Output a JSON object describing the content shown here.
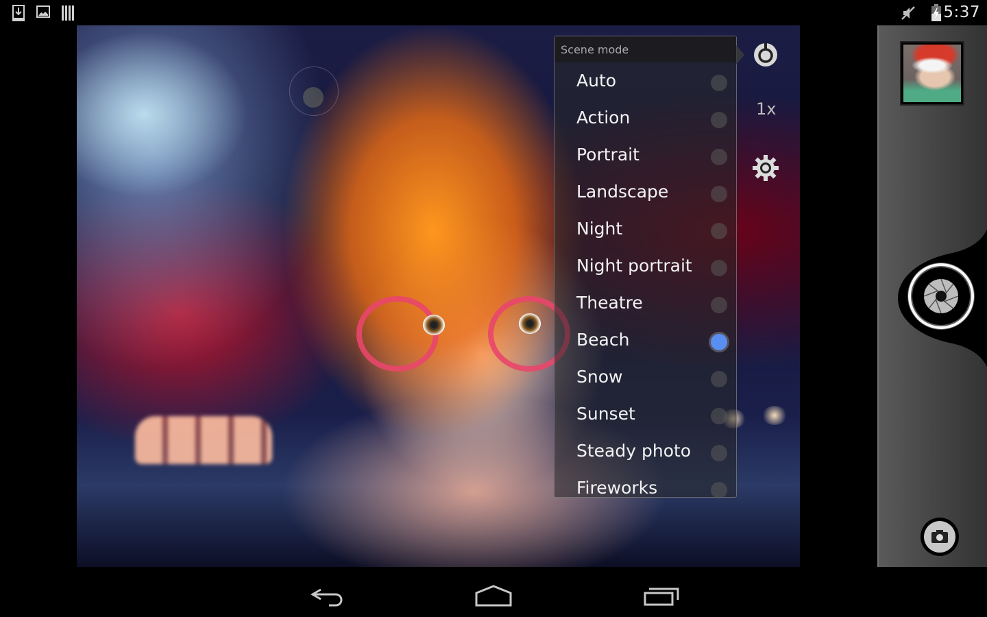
{
  "status_bar": {
    "left_icons": [
      "download-notification-icon",
      "gallery-notification-icon",
      "barcode-notification-icon"
    ],
    "right_icons": [
      "mute-icon",
      "battery-charging-icon"
    ],
    "time": "5:37"
  },
  "viewfinder": {
    "subject": "child with red glasses"
  },
  "scene_mode_popup": {
    "title": "Scene mode",
    "selected": "Beach",
    "options": [
      {
        "label": "Auto",
        "selected": false
      },
      {
        "label": "Action",
        "selected": false
      },
      {
        "label": "Portrait",
        "selected": false
      },
      {
        "label": "Landscape",
        "selected": false
      },
      {
        "label": "Night",
        "selected": false
      },
      {
        "label": "Night portrait",
        "selected": false
      },
      {
        "label": "Theatre",
        "selected": false
      },
      {
        "label": "Beach",
        "selected": true
      },
      {
        "label": "Snow",
        "selected": false
      },
      {
        "label": "Sunset",
        "selected": false
      },
      {
        "label": "Steady photo",
        "selected": false
      },
      {
        "label": "Fireworks",
        "selected": false
      }
    ]
  },
  "controls": {
    "scene_mode_icon": "scene-mode-icon",
    "zoom_level": "1x",
    "settings_icon": "gear-icon"
  },
  "right_panel": {
    "thumbnail": "last-photo-thumbnail",
    "shutter": "shutter-button",
    "switch_camera": "camera-switch-button"
  },
  "nav_bar": {
    "buttons": [
      "back",
      "home",
      "recent-apps"
    ]
  },
  "colors": {
    "accent_selected": "#5a8ef0",
    "menu_text": "#f2f2f2",
    "header_text": "#a8a8a8"
  }
}
